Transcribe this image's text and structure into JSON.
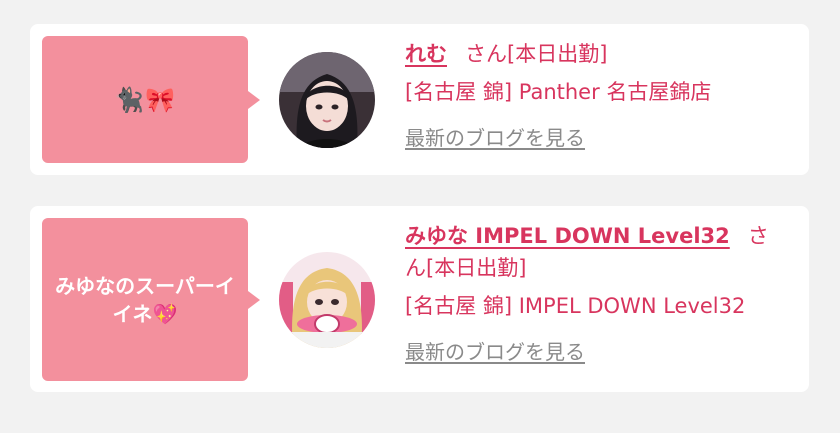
{
  "cards": [
    {
      "bubble": "🐈‍⬛🎀",
      "name": "れむ",
      "san": "さん[本日出勤]",
      "shop": "[名古屋 錦] Panther 名古屋錦店",
      "blog_link": "最新のブログを見る"
    },
    {
      "bubble": "みゆなのスーパーイイネ💖",
      "name": "みゆな IMPEL DOWN Level32",
      "san": "さん[本日出勤]",
      "shop": "[名古屋 錦] IMPEL DOWN Level32",
      "blog_link": "最新のブログを見る"
    }
  ],
  "colors": {
    "accent": "#d8355e",
    "bubble": "#f3909d",
    "link_gray": "#8a8a8a",
    "background": "#f2f2f2"
  }
}
